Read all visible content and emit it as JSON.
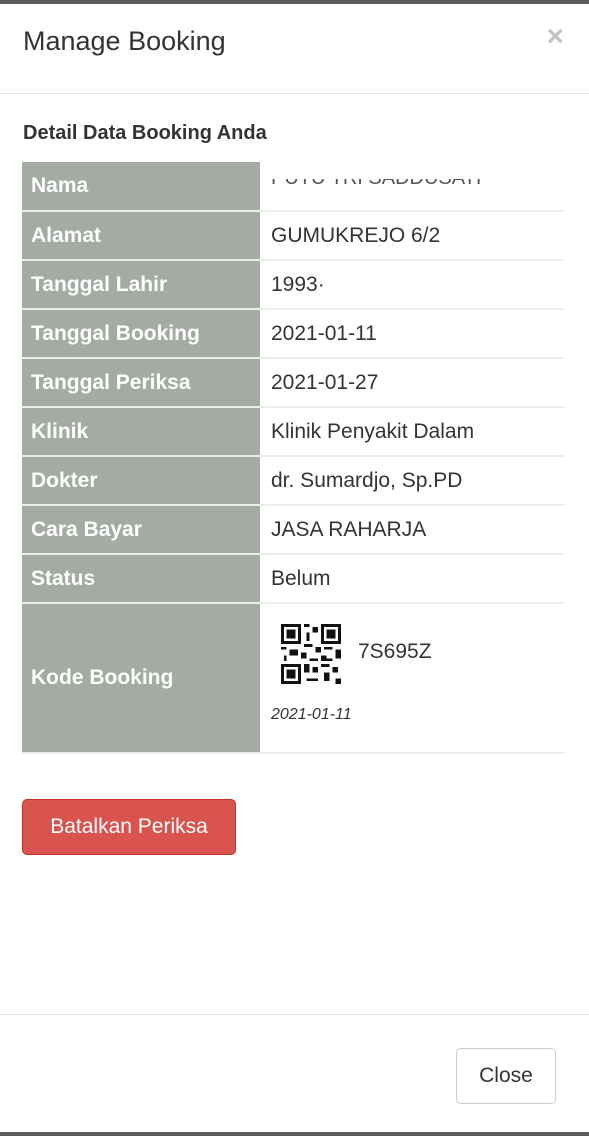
{
  "modal": {
    "title": "Manage Booking",
    "close_symbol": "×"
  },
  "section_title": "Detail Data Booking Anda",
  "rows": [
    {
      "label": "Nama",
      "value": "PUTU TRI SADDUSATI"
    },
    {
      "label": "Alamat",
      "value": "GUMUKREJO 6/2"
    },
    {
      "label": "Tanggal Lahir",
      "value": "1993·"
    },
    {
      "label": "Tanggal Booking",
      "value": "2021-01-11"
    },
    {
      "label": "Tanggal Periksa",
      "value": "2021-01-27"
    },
    {
      "label": "Klinik",
      "value": "Klinik Penyakit Dalam"
    },
    {
      "label": "Dokter",
      "value": "dr. Sumardjo, Sp.PD"
    },
    {
      "label": "Cara Bayar",
      "value": "JASA RAHARJA"
    },
    {
      "label": "Status",
      "value": "Belum"
    }
  ],
  "kode_booking": {
    "label": "Kode Booking",
    "code": "7S695Z",
    "date": "2021-01-11",
    "qr_icon": "qr-code-icon"
  },
  "buttons": {
    "cancel_label": "Batalkan Periksa",
    "close_label": "Close"
  },
  "colors": {
    "label_bg": "#a4aba3",
    "danger": "#d9534f"
  }
}
